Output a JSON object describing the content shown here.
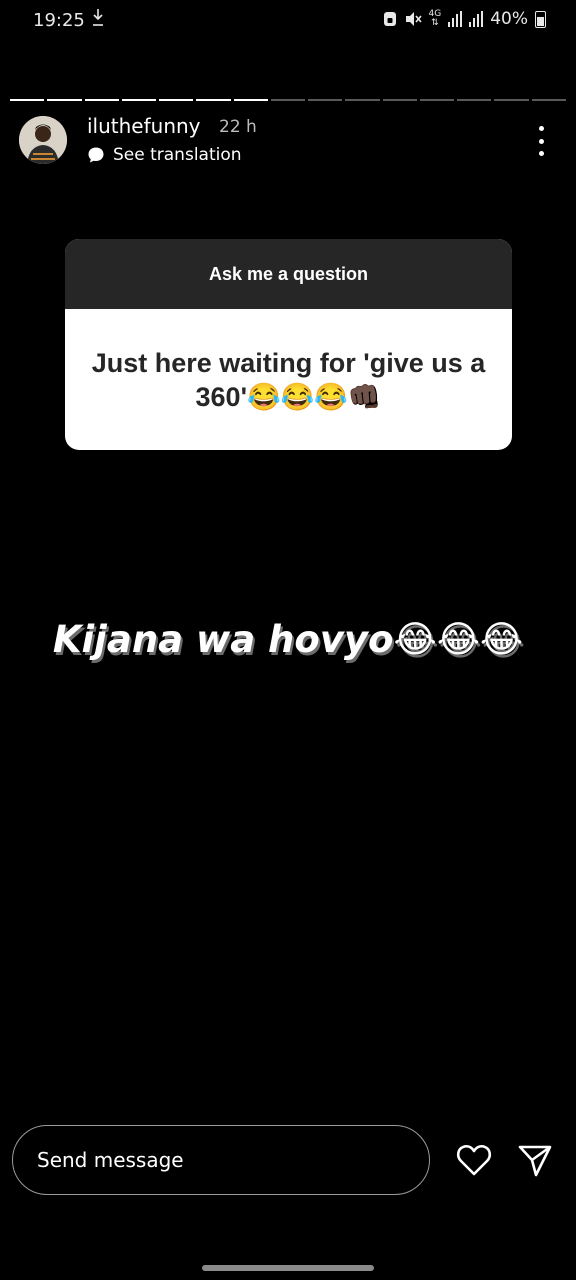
{
  "status_bar": {
    "time": "19:25",
    "network": "4G",
    "battery": "40%",
    "icons": [
      "download-icon",
      "nfc-lock-icon",
      "mute-icon",
      "signal-icon",
      "signal-icon",
      "battery-icon"
    ]
  },
  "story": {
    "segments_total": 15,
    "segments_done": 7,
    "username": "iluthefunny",
    "posted_ago": "22 h",
    "see_translation": "See translation"
  },
  "question_sticker": {
    "prompt": "Ask me a question",
    "answer": "Just here waiting for 'give us a 360'😂😂😂👊🏿"
  },
  "caption": "Kijana wa hovyo😂😂😂",
  "reply": {
    "placeholder": "Send message"
  },
  "colors": {
    "background": "#000000",
    "card_header": "#262626",
    "card_body": "#ffffff"
  }
}
